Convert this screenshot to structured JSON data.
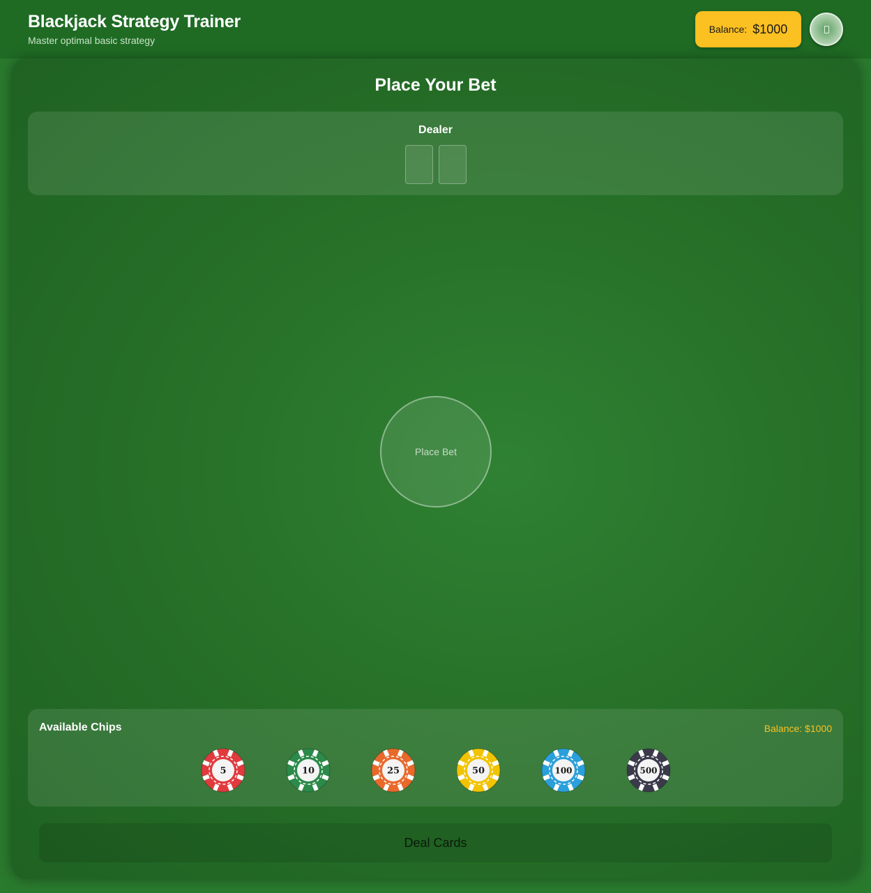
{
  "header": {
    "title": "Blackjack Strategy Trainer",
    "subtitle": "Master optimal basic strategy",
    "balance_label": "Balance:",
    "balance_value": "$1000",
    "menu_icon": "card-icon"
  },
  "table": {
    "title": "Place Your Bet",
    "dealer_label": "Dealer",
    "dealer_cards": [
      "",
      ""
    ],
    "bet_spot_label": "Place Bet"
  },
  "chips": {
    "title": "Available Chips",
    "balance_text": "Balance: $1000",
    "items": [
      {
        "value": "5",
        "color": "#e03a3e"
      },
      {
        "value": "10",
        "color": "#2c8a4a"
      },
      {
        "value": "25",
        "color": "#e8692c"
      },
      {
        "value": "50",
        "color": "#f2c300"
      },
      {
        "value": "100",
        "color": "#2b9fd9"
      },
      {
        "value": "500",
        "color": "#3a3a4a"
      }
    ]
  },
  "actions": {
    "deal_label": "Deal Cards"
  },
  "colors": {
    "felt": "#2a7a2e",
    "accent_gold": "#fbc021"
  }
}
